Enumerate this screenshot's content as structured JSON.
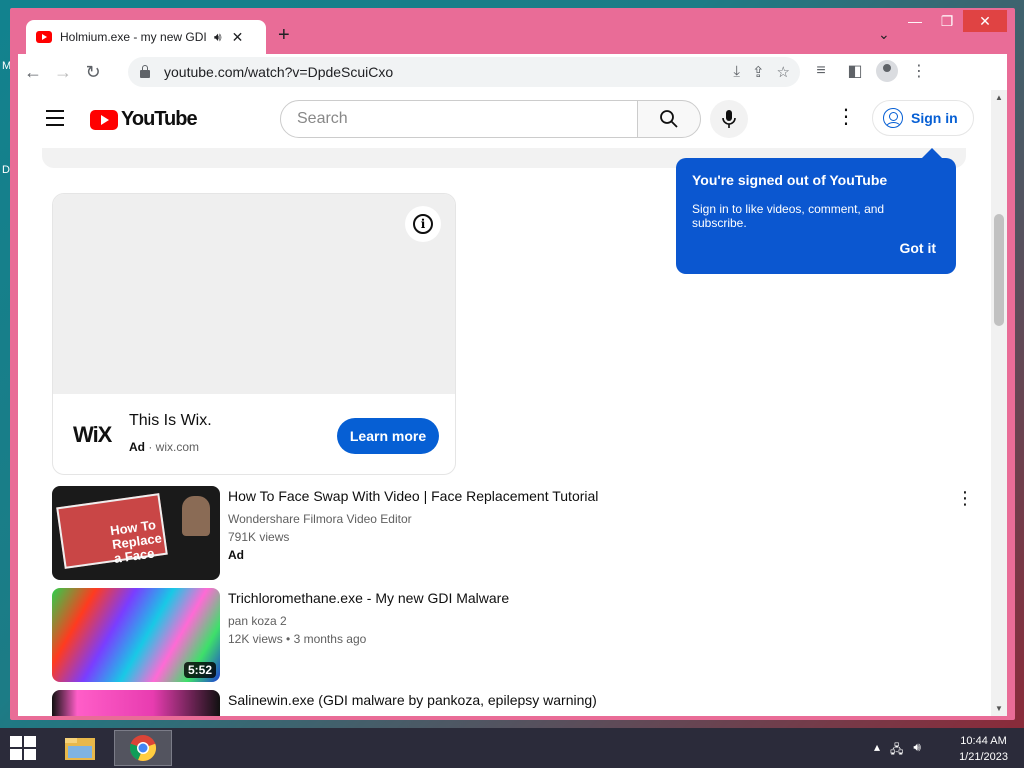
{
  "desktop": {
    "label_m": "M",
    "label_d": "D"
  },
  "browser": {
    "tab": {
      "title": "Holmium.exe - my new GDI Malware",
      "audio_icon": "speaker-icon"
    },
    "window_controls": {
      "minimize": "—",
      "maximize": "❐",
      "close": "✕"
    },
    "address": {
      "url": "youtube.com/watch?v=DpdeScuiCxo"
    }
  },
  "youtube": {
    "logo_text": "YouTube",
    "search": {
      "placeholder": "Search"
    },
    "sign_in_label": "Sign in",
    "popup": {
      "title": "You're signed out of YouTube",
      "body": "Sign in to like videos, comment, and subscribe.",
      "action": "Got it"
    },
    "ad": {
      "brand_logo": "WiX",
      "title": "This Is Wix.",
      "ad_label": "Ad",
      "domain": "wix.com",
      "cta": "Learn more"
    },
    "videos": [
      {
        "title": "How To Face Swap With Video | Face Replacement Tutorial",
        "channel": "Wondershare Filmora Video Editor",
        "views": "791K views",
        "badge": "Ad",
        "thumb_text": "How To Replace a Face"
      },
      {
        "title": "Trichloromethane.exe - My new GDI Malware",
        "channel": "pan koza 2",
        "views": "12K views",
        "age": "3 months ago",
        "duration": "5:52"
      },
      {
        "title": "Salinewin.exe (GDI malware by pankoza, epilepsy warning)"
      }
    ]
  },
  "taskbar": {
    "time": "10:44 AM",
    "date": "1/21/2023"
  },
  "colors": {
    "accent": "#065fd4",
    "popup_bg": "#0b57d0",
    "yt_red": "#ff0000",
    "frame": "#e96c97"
  }
}
